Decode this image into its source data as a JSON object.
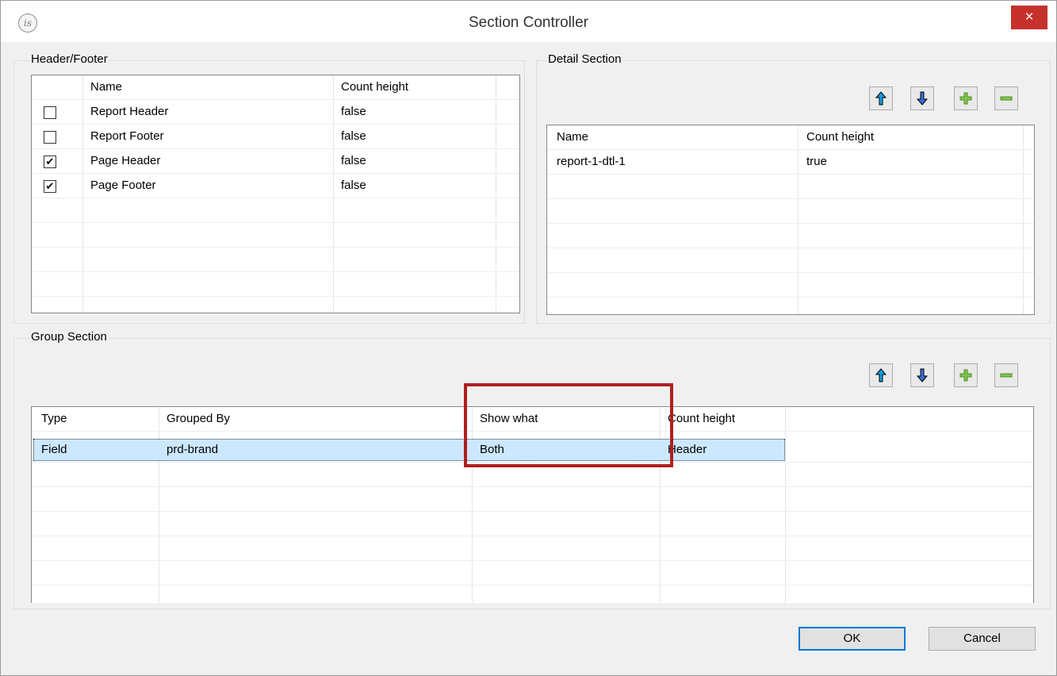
{
  "window": {
    "title": "Section Controller",
    "app_icon": "is",
    "close_glyph": "×"
  },
  "header_footer": {
    "label": "Header/Footer",
    "columns": [
      "Name",
      "Count height"
    ],
    "rows": [
      {
        "checked": false,
        "name": "Report Header",
        "count_height": "false"
      },
      {
        "checked": false,
        "name": "Report Footer",
        "count_height": "false"
      },
      {
        "checked": true,
        "name": "Page Header",
        "count_height": "false"
      },
      {
        "checked": true,
        "name": "Page Footer",
        "count_height": "false"
      }
    ]
  },
  "detail_section": {
    "label": "Detail Section",
    "toolbar": [
      "arrow-up-icon",
      "arrow-down-icon",
      "plus-icon",
      "minus-icon"
    ],
    "columns": [
      "Name",
      "Count height"
    ],
    "rows": [
      {
        "name": "report-1-dtl-1",
        "count_height": "true"
      }
    ]
  },
  "group_section": {
    "label": "Group Section",
    "toolbar": [
      "arrow-up-icon",
      "arrow-down-icon",
      "plus-icon",
      "minus-icon"
    ],
    "columns": [
      "Type",
      "Grouped By",
      "Show what",
      "Count height"
    ],
    "rows": [
      {
        "type": "Field",
        "grouped_by": "prd-brand",
        "show_what": "Both",
        "count_height": "Header"
      }
    ]
  },
  "buttons": {
    "ok": "OK",
    "cancel": "Cancel"
  },
  "colors": {
    "close_button": "#c7312c",
    "selection": "#cce8ff",
    "highlight": "#b01e1e",
    "arrow_up": "#0aa0e6",
    "plus": "#7ec44a",
    "minus": "#7ec44a"
  }
}
